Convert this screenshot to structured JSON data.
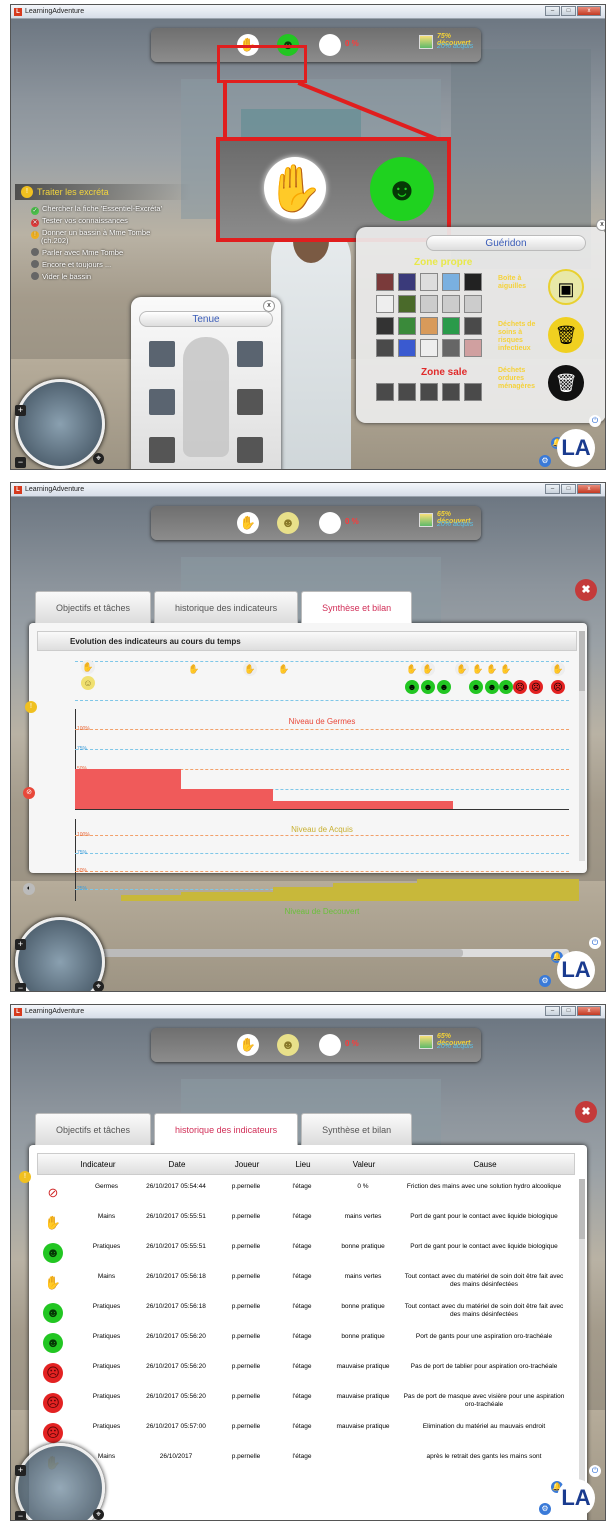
{
  "app": {
    "title": "LearningAdventure",
    "icon_letter": "L"
  },
  "window_buttons": {
    "min": "–",
    "max": "□",
    "close": "x"
  },
  "hud": {
    "hand_icon": "hand-icon",
    "hand_glyph": "✋",
    "smile_glyph": "☻",
    "percent": "0 %",
    "decouvert_1": "75% découvert",
    "acquis_1": "20% acquis",
    "decouvert_2": "65% découvert",
    "acquis_2": "20% acquis",
    "decouvert_3": "65% découvert",
    "acquis_3": "20% acquis"
  },
  "colors": {
    "accent": "#d12e57",
    "highlight": "#e01e1e",
    "green": "#22c622",
    "red": "#e32222"
  },
  "tasks": {
    "title": "Traiter les excréta",
    "items": [
      {
        "label": "Chercher la fiche 'Essentiel-Excréta'",
        "status": "done"
      },
      {
        "label": "Tester vos connaissances",
        "status": "failed"
      },
      {
        "label": "Donner un bassin à Mme Tombe",
        "status": "active"
      },
      {
        "label": "(ch.202)",
        "status": "sub"
      },
      {
        "label": "Parler avec Mme Tombe",
        "status": "todo"
      },
      {
        "label": "Encore et toujours ...",
        "status": "todo"
      },
      {
        "label": "Vider le bassin",
        "status": "todo"
      }
    ]
  },
  "tenue": {
    "title": "Tenue",
    "close": "x"
  },
  "gueridon": {
    "title": "Guéridon",
    "close": "x",
    "zone_propre": "Zone propre",
    "zone_sale": "Zone sale",
    "bins": [
      {
        "label": "Boîte à aiguilles",
        "icon": "needle-box-icon"
      },
      {
        "label": "Déchets de soins à risques infectieux",
        "icon": "infectious-waste-icon"
      },
      {
        "label": "Déchets ordures ménagères",
        "icon": "trash-icon"
      }
    ]
  },
  "minimap": {
    "plus": "+",
    "minus": "−",
    "target": "⌖"
  },
  "logo": "LA",
  "dialog": {
    "tabs": [
      "Objectifs et tâches",
      "historique des indicateurs",
      "Synthèse et bilan"
    ],
    "close": "✖",
    "synthese": {
      "header": "Evolution des indicateurs au cours du temps",
      "germes_title": "Niveau de Germes",
      "acquis_title": "Niveau de Acquis",
      "decouvert_title": "Niveau de Decouvert",
      "pct_labels": [
        "100%",
        "75%",
        "50%",
        "25%"
      ]
    },
    "historique": {
      "columns": [
        "Indicateur",
        "Date",
        "Joueur",
        "Lieu",
        "Valeur",
        "Cause"
      ],
      "rows": [
        {
          "icon": "bacteria-icon",
          "indicateur": "Germes",
          "date": "26/10/2017 05:54:44",
          "joueur": "p.pernelle",
          "lieu": "l'étage",
          "valeur": "0 %",
          "cause": "Friction des mains avec une solution hydro alcoolique"
        },
        {
          "icon": "hand-icon",
          "indicateur": "Mains",
          "date": "26/10/2017 05:55:51",
          "joueur": "p.pernelle",
          "lieu": "l'étage",
          "valeur": "mains vertes",
          "cause": "Port de gant pour le contact avec liquide biologique"
        },
        {
          "icon": "green-smile-icon",
          "indicateur": "Pratiques",
          "date": "26/10/2017 05:55:51",
          "joueur": "p.pernelle",
          "lieu": "l'étage",
          "valeur": "bonne pratique",
          "cause": "Port de gant pour le contact avec liquide biologique"
        },
        {
          "icon": "hand-icon",
          "indicateur": "Mains",
          "date": "26/10/2017 05:56:18",
          "joueur": "p.pernelle",
          "lieu": "l'étage",
          "valeur": "mains vertes",
          "cause": "Tout contact avec du matériel de soin doit être fait avec des mains désinfectées"
        },
        {
          "icon": "green-smile-icon",
          "indicateur": "Pratiques",
          "date": "26/10/2017 05:56:18",
          "joueur": "p.pernelle",
          "lieu": "l'étage",
          "valeur": "bonne pratique",
          "cause": "Tout contact avec du matériel de soin doit être fait avec des mains désinfectées"
        },
        {
          "icon": "green-smile-icon",
          "indicateur": "Pratiques",
          "date": "26/10/2017 05:56:20",
          "joueur": "p.pernelle",
          "lieu": "l'étage",
          "valeur": "bonne pratique",
          "cause": "Port de gants pour une aspiration oro-trachéale"
        },
        {
          "icon": "red-face-icon",
          "indicateur": "Pratiques",
          "date": "26/10/2017 05:56:20",
          "joueur": "p.pernelle",
          "lieu": "l'étage",
          "valeur": "mauvaise pratique",
          "cause": "Pas de port de tablier pour aspiration oro-trachéale"
        },
        {
          "icon": "red-face-icon",
          "indicateur": "Pratiques",
          "date": "26/10/2017 05:56:20",
          "joueur": "p.pernelle",
          "lieu": "l'étage",
          "valeur": "mauvaise pratique",
          "cause": "Pas de port de masque avec visière pour une aspiration oro-trachéale"
        },
        {
          "icon": "red-face-icon",
          "indicateur": "Pratiques",
          "date": "26/10/2017 05:57:00",
          "joueur": "p.pernelle",
          "lieu": "l'étage",
          "valeur": "mauvaise pratique",
          "cause": "Elimination du matériel au mauvais endroit"
        },
        {
          "icon": "hand-icon",
          "indicateur": "Mains",
          "date": "26/10/2017",
          "joueur": "p.pernelle",
          "lieu": "l'étage",
          "valeur": "",
          "cause": "après le retrait des gants les mains sont"
        }
      ]
    }
  }
}
